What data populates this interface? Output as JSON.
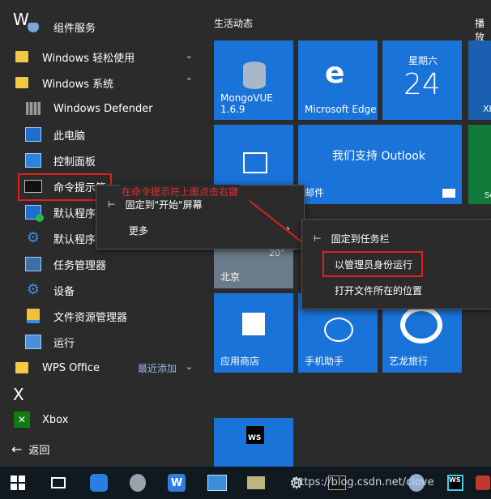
{
  "start": {
    "letter_w": "W",
    "letter_x": "X",
    "partial_item": "组件服务",
    "items": [
      {
        "label": "Windows 轻松使用"
      },
      {
        "label": "Windows 系统"
      },
      {
        "label": "Windows Defender"
      },
      {
        "label": "此电脑"
      },
      {
        "label": "控制面板"
      },
      {
        "label": "命令提示符"
      },
      {
        "label": "默认程序"
      },
      {
        "label": "默认程序"
      },
      {
        "label": "任务管理器"
      },
      {
        "label": "设备"
      },
      {
        "label": "文件资源管理器"
      },
      {
        "label": "运行"
      }
    ],
    "wps": {
      "label": "WPS Office",
      "badge": "最近添加"
    },
    "xbox": "Xbox",
    "back": "返回"
  },
  "tiles": {
    "section_title": "生活动态",
    "section_title2": "播放",
    "mongo": {
      "name": "MongoVUE",
      "version": "1.6.9"
    },
    "edge": "Microsoft Edge",
    "calendar": {
      "weekday": "星期六",
      "day": "24"
    },
    "outlook": "我们支持 Outlook",
    "mail": "邮件",
    "weather_city": "北京",
    "weather_temp": "20°",
    "store": "应用商店",
    "phone": "手机助手",
    "elong": "艺龙旅行",
    "cut_right": "Xb",
    "cut_right2": "So"
  },
  "menus": {
    "pin_start": "固定到\"开始\"屏幕",
    "more": "更多",
    "pin_taskbar": "固定到任务栏",
    "run_admin": "以管理员身份运行",
    "open_location": "打开文件所在的位置"
  },
  "annotation": "在命令提示符上面点击右键",
  "watermark": "https://blog.csdn.net/clove",
  "colors": {
    "tile_blue": "#1a73d9",
    "annotation_red": "#e02020"
  }
}
